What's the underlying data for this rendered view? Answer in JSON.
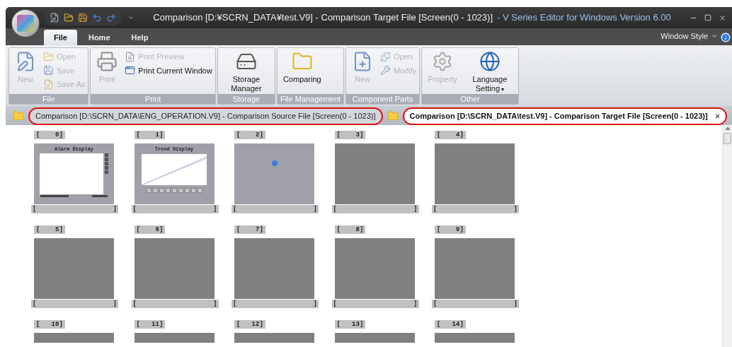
{
  "window": {
    "title": "Comparison [D:¥SCRN_DATA¥test.V9] - Comparison Target File [Screen(0 - 1023)]",
    "app_name": "- V Series Editor for Windows Version 6.00"
  },
  "menu_tabs": [
    {
      "label": "File",
      "selected": true
    },
    {
      "label": "Home",
      "selected": false
    },
    {
      "label": "Help",
      "selected": false
    }
  ],
  "window_style": "Window Style",
  "ribbon_groups": [
    {
      "label": "File",
      "items": [
        {
          "kind": "large",
          "label": "New",
          "disabled": true
        },
        {
          "kind": "stack",
          "entries": [
            {
              "label": "Open",
              "disabled": true
            },
            {
              "label": "Save",
              "disabled": true
            },
            {
              "label": "Save As",
              "disabled": true
            }
          ]
        }
      ]
    },
    {
      "label": "Print",
      "items": [
        {
          "kind": "large",
          "label": "Print",
          "disabled": true
        },
        {
          "kind": "stack",
          "entries": [
            {
              "label": "Print Preview",
              "disabled": true
            },
            {
              "label": "Print Current Window",
              "disabled": false
            }
          ]
        }
      ]
    },
    {
      "label": "Storage",
      "items": [
        {
          "kind": "large",
          "label": "Storage Manager",
          "disabled": false
        }
      ]
    },
    {
      "label": "File Management",
      "items": [
        {
          "kind": "large",
          "label": "Comparing",
          "disabled": false
        }
      ]
    },
    {
      "label": "Component Parts",
      "items": [
        {
          "kind": "large",
          "label": "New",
          "disabled": true
        },
        {
          "kind": "stack",
          "entries": [
            {
              "label": "Open",
              "disabled": true
            },
            {
              "label": "Modify",
              "disabled": true
            }
          ]
        }
      ]
    },
    {
      "label": "Other",
      "items": [
        {
          "kind": "large",
          "label": "Property",
          "disabled": true
        },
        {
          "kind": "large",
          "label": "Language Setting",
          "disabled": false,
          "dropdown": "▾"
        }
      ]
    }
  ],
  "doc_tabs": [
    {
      "label": "Comparison [D:\\SCRN_DATA\\ENG_OPERATION.V9] - Comparison Source File [Screen(0 - 1023)]",
      "selected": false,
      "highlighted": true
    },
    {
      "label": "Comparison [D:\\SCRN_DATA\\test.V9] - Comparison Target File [Screen(0 - 1023)]",
      "selected": true,
      "highlighted": true,
      "close": "×"
    }
  ],
  "screens": [
    {
      "number": "[    0]",
      "kind": "alarm",
      "title": "Alarm Display",
      "caption_open": "[",
      "caption_close": "]"
    },
    {
      "number": "[    1]",
      "kind": "trend",
      "title": "Trend Display",
      "caption_open": "[",
      "caption_close": "]"
    },
    {
      "number": "[    2]",
      "kind": "dot",
      "caption_open": "[",
      "caption_close": "]"
    },
    {
      "number": "[    3]",
      "kind": "blank",
      "caption_open": "[",
      "caption_close": "]"
    },
    {
      "number": "[    4]",
      "kind": "blank",
      "caption_open": "[",
      "caption_close": "]"
    },
    {
      "number": "[    5]",
      "kind": "blank",
      "caption_open": "[",
      "caption_close": "]"
    },
    {
      "number": "[    6]",
      "kind": "blank",
      "caption_open": "[",
      "caption_close": "]"
    },
    {
      "number": "[    7]",
      "kind": "blank",
      "caption_open": "[",
      "caption_close": "]"
    },
    {
      "number": "[    8]",
      "kind": "blank",
      "caption_open": "[",
      "caption_close": "]"
    },
    {
      "number": "[    9]",
      "kind": "blank",
      "caption_open": "[",
      "caption_close": "]"
    },
    {
      "number": "[   10]",
      "kind": "partial"
    },
    {
      "number": "[   11]",
      "kind": "partial"
    },
    {
      "number": "[   12]",
      "kind": "partial"
    },
    {
      "number": "[   13]",
      "kind": "partial"
    },
    {
      "number": "[   14]",
      "kind": "partial"
    }
  ]
}
